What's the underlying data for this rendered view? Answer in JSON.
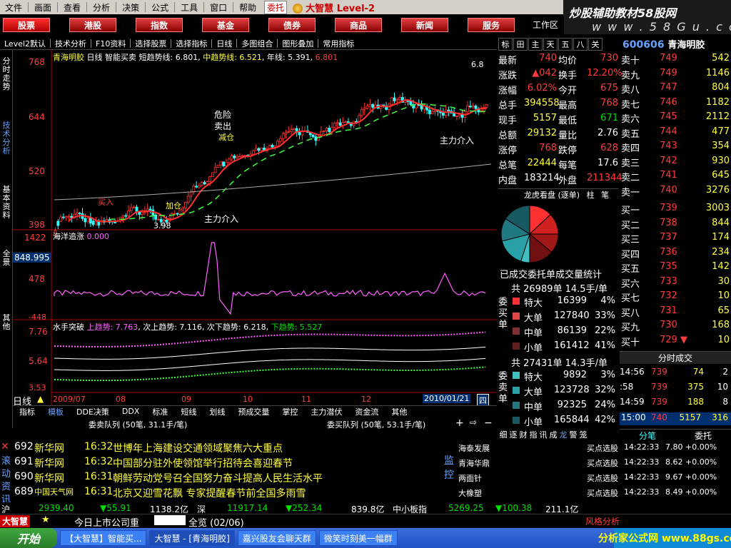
{
  "menu": [
    "文件",
    "画面",
    "查看",
    "分析",
    "决策",
    "公式",
    "工具",
    "窗口",
    "帮助"
  ],
  "menu_button": "委托",
  "brand": {
    "name": "大智慧",
    "edition": "Level-2"
  },
  "banner": {
    "line1": "炒股辅助教材58股网",
    "line2": "w w w . 5 8 G u . c o m"
  },
  "main_tabs": [
    "股票",
    "港股",
    "指数",
    "基金",
    "债券",
    "商品",
    "新闻",
    "服务"
  ],
  "work_area": "工作区",
  "toolbar": [
    "Level2默认",
    "技术分析",
    "F10资料",
    "选择股票",
    "选择指标",
    "日线",
    "多图组合",
    "图形叠加",
    "常用指标"
  ],
  "left_tabs": [
    "分时走势",
    "技术分析",
    "基本资料",
    "全景",
    "其他"
  ],
  "chart": {
    "stock_name": "青海明胶",
    "period": "日线",
    "indicator": "智能买卖",
    "ma_short_label": "短趋势线: 6.801",
    "ma_mid_label": "中趋势线: 6.521",
    "ma_long_label": "年线: 5.391",
    "last_label": "6.801",
    "price_ticks": [
      "768",
      "644",
      "520",
      "398"
    ],
    "annotations": [
      "危险",
      "卖出",
      "减仓",
      "买入",
      "加仓",
      "主力介入",
      "主力介入",
      "主力介入",
      "3.98",
      "6.8"
    ],
    "panel2_title": "海洋追涨",
    "panel2_value": "0.000",
    "panel2_ticks": [
      "1422",
      "848.995",
      "478",
      "-448"
    ],
    "panel3_title": "水手突破",
    "panel3_up": "上趋势: 7.763",
    "panel3_next_up": "次上趋势: 7.116",
    "panel3_next_down": "次下趋势: 6.218",
    "panel3_down": "下趋势: 5.527",
    "panel3_ticks": [
      "7.76",
      "5.64",
      "3.53"
    ],
    "date_labels": [
      "2009/07",
      "08",
      "09",
      "10",
      "11",
      "12"
    ],
    "current_date": "2010/01/21",
    "weekday": "四",
    "period_button": "日线"
  },
  "quote_tabs": [
    "标",
    "田",
    "主",
    "天",
    "五",
    "八",
    "关"
  ],
  "stock_code": "600606",
  "stock_code_name": "青海明胶",
  "quote": [
    [
      "最新",
      "740",
      "均价",
      "730"
    ],
    [
      "涨跌",
      "▲042",
      "换手",
      "12.20%"
    ],
    [
      "涨幅",
      "6.02%",
      "今开",
      "675"
    ],
    [
      "总手",
      "394558",
      "最高",
      "768"
    ],
    [
      "现手",
      "5157",
      "最低",
      "671"
    ],
    [
      "总额",
      "29132",
      "量比",
      "2.76"
    ],
    [
      "涨停",
      "768",
      "跌停",
      "628"
    ],
    [
      "总笔",
      "22444",
      "每笔",
      "17.6"
    ],
    [
      "内盘",
      "183214",
      "外盘",
      "211344"
    ]
  ],
  "longhu": {
    "title": "龙虎看盘 (逐单)",
    "tabs": [
      "柱",
      "笔"
    ]
  },
  "pie_slices": [
    {
      "label": "特大买",
      "pct": 0.13,
      "color": "#ff3030"
    },
    {
      "label": "大单买",
      "pct": 0.12,
      "color": "#d02020"
    },
    {
      "label": "中单买",
      "pct": 0.11,
      "color": "#a01818"
    },
    {
      "label": "小单买",
      "pct": 0.14,
      "color": "#701010"
    },
    {
      "label": "特大卖",
      "pct": 0.05,
      "color": "#40c0c0"
    },
    {
      "label": "大单卖",
      "pct": 0.16,
      "color": "#2aa0a8"
    },
    {
      "label": "中单卖",
      "pct": 0.13,
      "color": "#207880"
    },
    {
      "label": "小单卖",
      "pct": 0.16,
      "color": "#185860"
    }
  ],
  "vol_label": "已成交委托单成交量统计",
  "buy_side": {
    "label": "委买单",
    "total": "共 26989单 14.5手/单",
    "rows": [
      [
        "特大",
        "16399",
        "4%"
      ],
      [
        "大单",
        "127840",
        "33%"
      ],
      [
        "中单",
        "86139",
        "22%"
      ],
      [
        "小单",
        "161412",
        "41%"
      ]
    ]
  },
  "sell_side": {
    "label": "委卖单",
    "total": "共 27431单 14.3手/单",
    "rows": [
      [
        "特大",
        "9892",
        "3%"
      ],
      [
        "大单",
        "123728",
        "32%"
      ],
      [
        "中单",
        "92325",
        "24%"
      ],
      [
        "小单",
        "165844",
        "42%"
      ]
    ]
  },
  "sell_book": [
    [
      "卖十",
      "749",
      "542"
    ],
    [
      "卖九",
      "749",
      "1146"
    ],
    [
      "卖八",
      "747",
      "804"
    ],
    [
      "卖七",
      "746",
      "1182"
    ],
    [
      "卖六",
      "745",
      "2112"
    ],
    [
      "卖五",
      "744",
      "477"
    ],
    [
      "卖四",
      "743",
      "354"
    ],
    [
      "卖三",
      "742",
      "930"
    ],
    [
      "卖二",
      "741",
      "645"
    ],
    [
      "卖一",
      "740",
      "3276"
    ]
  ],
  "buy_book": [
    [
      "买一",
      "739",
      "3003"
    ],
    [
      "买二",
      "738",
      "844"
    ],
    [
      "买三",
      "737",
      "174"
    ],
    [
      "买四",
      "736",
      "234"
    ],
    [
      "买五",
      "735",
      "142"
    ],
    [
      "买六",
      "733",
      "30"
    ],
    [
      "买七",
      "732",
      "10"
    ],
    [
      "买八",
      "731",
      "65"
    ],
    [
      "买九",
      "730",
      "168"
    ],
    [
      "买十",
      "729 ▼",
      "10"
    ]
  ],
  "ticks": {
    "title": "分时成交",
    "rows": [
      [
        "14:56",
        "739",
        "74",
        "2"
      ],
      [
        ":58",
        "739",
        "375",
        "10"
      ],
      [
        "14:59",
        "739",
        "188",
        "8"
      ]
    ],
    "last": [
      "15:00",
      "740",
      "5157",
      "316"
    ]
  },
  "right_subtabs": [
    "分笔",
    "委托"
  ],
  "bottom_tabs": [
    "指标",
    "模板",
    "DDE决策",
    "DDX",
    "标准",
    "短线",
    "划线",
    "预成交量",
    "掌控",
    "主力潜伏",
    "资金流",
    "其他"
  ],
  "queue": {
    "buy": "委卖队列 (50笔, 31.1手/笔)",
    "sell": "委买队列 (50笔, 53.1手/笔)"
  },
  "detail_tabs": [
    "细",
    "逐",
    "财",
    "指",
    "讯",
    "成",
    "龙",
    "警",
    "笼"
  ],
  "news_side": "滚动资讯",
  "news": [
    {
      "id": "692",
      "src": "新华网",
      "time": "16:32",
      "title": "世博年上海建设交通领域聚焦六大重点"
    },
    {
      "id": "691",
      "src": "新华网",
      "time": "16:32",
      "title": "中国部分驻外使领馆举行招待会喜迎春节"
    },
    {
      "id": "690",
      "src": "新华网",
      "time": "16:31",
      "title": "朝鲜劳动党号召全国努力奋斗提高人民生活水平"
    },
    {
      "id": "689",
      "src": "中国天气网",
      "time": "16:31",
      "title": "北京又迎雪花飘 专家提醒春节前全国多雨雪"
    }
  ],
  "alerts_side": "监控",
  "alerts": [
    {
      "name": "海泰发展",
      "type": "买点选股",
      "time": "14:22:33",
      "val": "7.80",
      "chg": "+0.00%"
    },
    {
      "name": "青海华鼎",
      "type": "买点选股",
      "time": "14:22:33",
      "val": "8.62",
      "chg": "+0.00%"
    },
    {
      "name": "两面针",
      "type": "买点选股",
      "time": "14:22:33",
      "val": "9.67",
      "chg": "+0.00%"
    },
    {
      "name": "大橡塑",
      "type": "买点选股",
      "time": "14:22:33",
      "val": "8.49",
      "chg": "+0.00%"
    }
  ],
  "indexbar": {
    "sh_label": "沪",
    "sh_val": "2939.40",
    "sh_chg": "▼55.91",
    "sh_amt": "1138.2亿",
    "sz_label": "深",
    "sz_val": "11917.14",
    "sz_chg": "▼252.34",
    "sz_amt": "839.8亿",
    "sme_label": "中小板指",
    "sme_val": "5269.25",
    "sme_chg": "▼100.38",
    "sme_amt": "211.1亿"
  },
  "bottombar": {
    "logo": "大智慧",
    "ticker": "今日上市公司重",
    "status": "全览 (02/06)",
    "right": "风格分析"
  },
  "taskbar": {
    "start": "开始",
    "tasks": [
      "【大智慧】智能买...",
      "大智慧 - [青海明胶]",
      "嘉兴股友会聊天群",
      "微笑时刻美一幅群"
    ],
    "tray": "分析家公式网 www.88gs.com"
  }
}
